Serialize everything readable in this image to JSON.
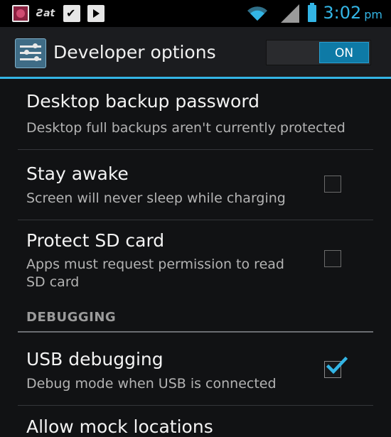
{
  "status_bar": {
    "notification_icons": [
      "photo-icon",
      "logo-icon",
      "clipboard-check-icon",
      "play-store-icon"
    ],
    "logo_text": "Ƨat",
    "time": "3:02",
    "ampm": "pm",
    "accent_color": "#33b5e5"
  },
  "action_bar": {
    "title": "Developer options",
    "toggle_label": "ON",
    "toggle_state": "on"
  },
  "settings": [
    {
      "title": "Desktop backup password",
      "summary": "Desktop full backups aren't currently protected"
    },
    {
      "title": "Stay awake",
      "summary": "Screen will never sleep while charging",
      "checked": false
    },
    {
      "title": "Protect SD card",
      "summary_line1": "Apps must request permission to read",
      "summary_line2": "SD card",
      "checked": false
    }
  ],
  "section": {
    "header": "DEBUGGING",
    "items": [
      {
        "title": "USB debugging",
        "summary": "Debug mode when USB is connected",
        "checked": true
      },
      {
        "title": "Allow mock locations"
      }
    ]
  }
}
